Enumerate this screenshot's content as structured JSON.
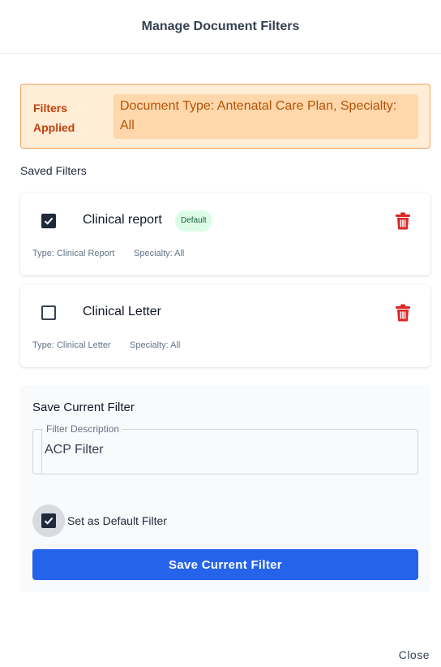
{
  "dialog": {
    "title": "Manage Document Filters"
  },
  "applied": {
    "label_line1": "Filters",
    "label_line2": "Applied",
    "values": "Document Type: Antenatal Care Plan, Specialty: All",
    "colors": {
      "background": "#ffedd5",
      "border": "#f6a35f",
      "text": "#c2410c"
    }
  },
  "saved": {
    "section_label": "Saved Filters",
    "filters": [
      {
        "name": "Clinical report",
        "checked": true,
        "badge": "Default",
        "type": "Type: Clinical Report",
        "specialty": "Specialty: All",
        "delete_icon": "trash-icon"
      },
      {
        "name": "Clinical Letter",
        "checked": false,
        "type": "Type: Clinical Letter",
        "specialty": "Specialty: All",
        "delete_icon": "trash-icon"
      }
    ]
  },
  "save_form": {
    "title": "Save Current Filter",
    "description_label": "Filter Description",
    "description_value": "ACP Filter",
    "default_label": "Set as Default Filter",
    "default_checked": true,
    "button_label": "Save Current Filter",
    "button_color": "#2563eb"
  },
  "footer": {
    "close_label": "Close"
  },
  "colors": {
    "danger": "#dc2626",
    "checkbox": "#1e293b",
    "badge_bg": "#dcfce7"
  }
}
